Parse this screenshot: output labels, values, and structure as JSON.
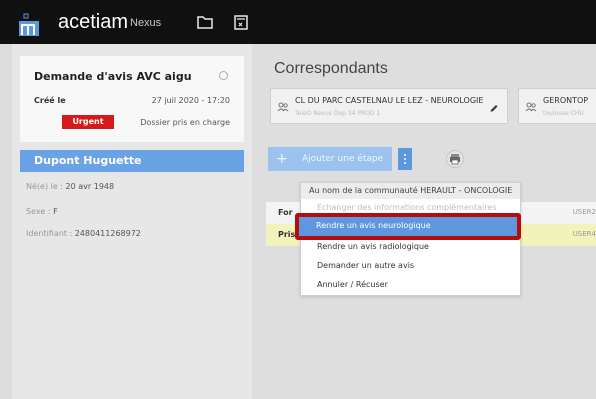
{
  "app": {
    "brand": "acetiam",
    "brand_sub": "Nexus"
  },
  "topbar": {
    "icons": [
      "folder-icon",
      "calendar-icon"
    ]
  },
  "request": {
    "title": "Demande d'avis AVC aigu",
    "created_label": "Créé le",
    "created_date": "27 juil 2020 - 17:20",
    "urgency": "Urgent",
    "status": "Dossier pris en charge"
  },
  "patient": {
    "name": "Dupont Huguette",
    "birth_label": "Né(e) le : ",
    "birth_value": "20 avr 1948",
    "sex_label": "Sexe : ",
    "sex_value": "F",
    "id_label": "Identifiant : ",
    "id_value": "2480411268972"
  },
  "correspondants": {
    "title": "Correspondants",
    "items": [
      {
        "name": "CL DU PARC CASTELNAU LE LEZ - NEUROLOGIE",
        "sub": "TeleO Nexus Dep 34 PROD 1"
      },
      {
        "name": "GERONTOP",
        "sub": "toulouse CHU"
      }
    ]
  },
  "actions": {
    "add_step": "Ajouter une étape"
  },
  "table": {
    "rows": [
      {
        "label": "For",
        "user": "USER2"
      },
      {
        "label": "Pris",
        "user": "USER4"
      }
    ]
  },
  "menu": {
    "header": "Au nom de la communauté HERAULT - ONCOLOGIE",
    "items": [
      "Echanger des informations complémentaires",
      "Rendre un avis neurologique",
      "Rendre un avis radiologique",
      "Demander un autre avis",
      "Annuler / Récuser"
    ]
  },
  "colors": {
    "accent": "#6aa2e6",
    "urgent": "#d61a1a",
    "highlight_border": "#b50d0d"
  }
}
